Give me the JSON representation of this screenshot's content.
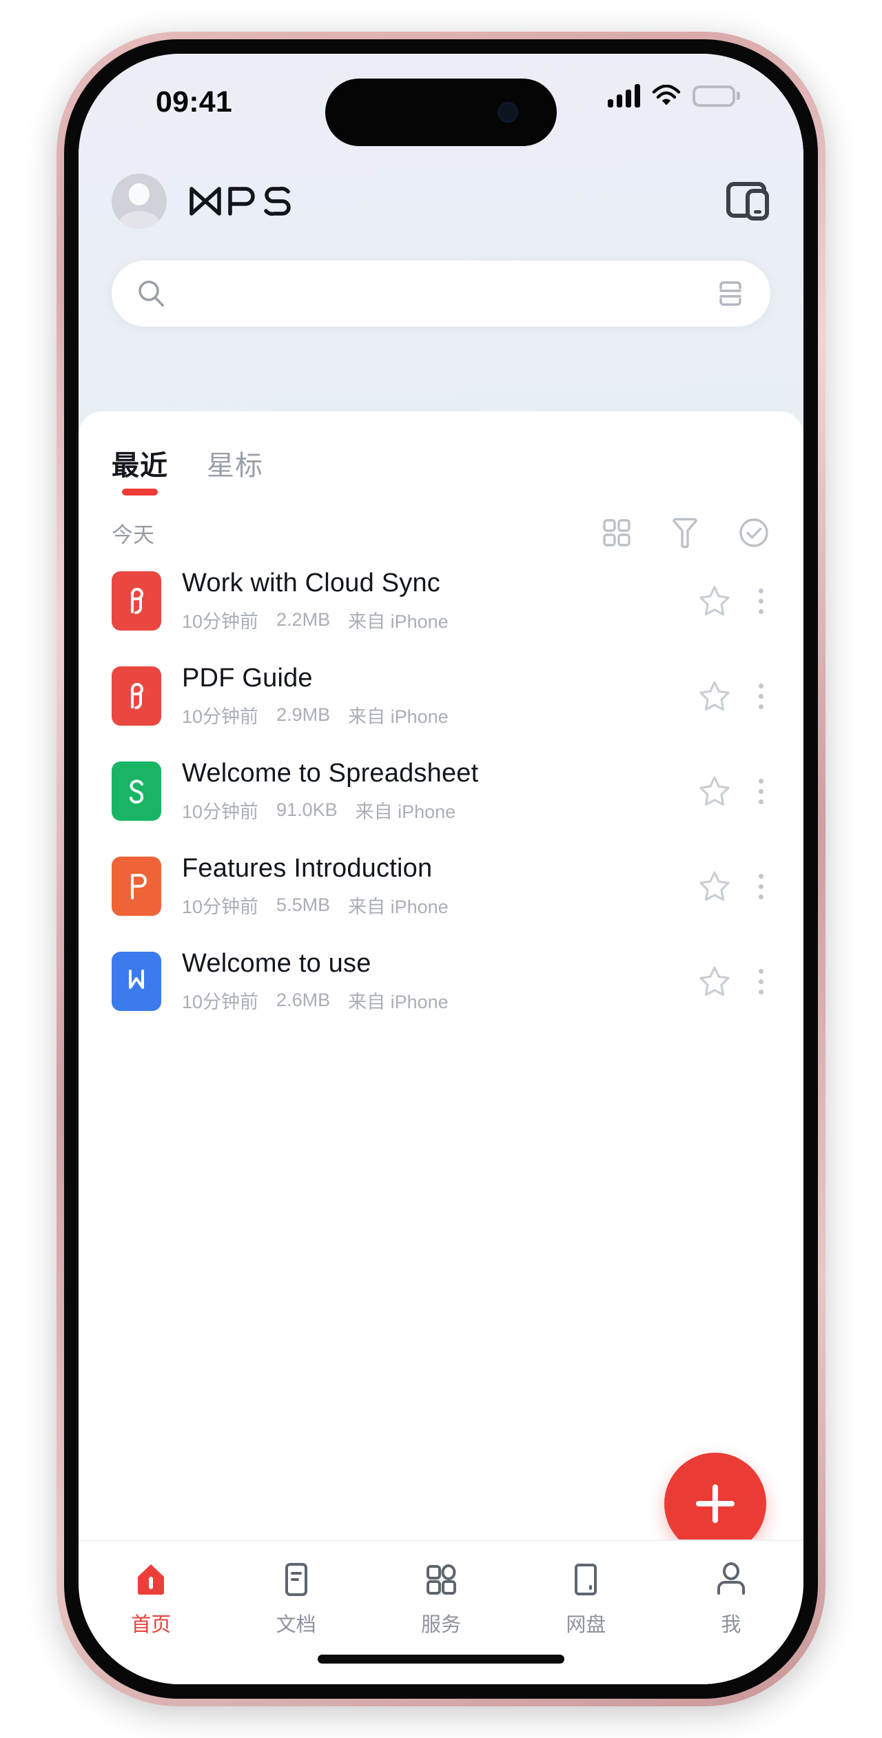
{
  "status_bar": {
    "time": "09:41",
    "signal_icon": "cellular-signal-icon",
    "wifi_icon": "wifi-icon",
    "battery_icon": "battery-full-icon"
  },
  "header": {
    "avatar": "user-avatar",
    "brand": "WPS",
    "cast_icon": "multi-screen-cast-icon"
  },
  "search": {
    "placeholder": "",
    "value": "",
    "search_icon": "search-icon",
    "scan_icon": "document-scan-icon"
  },
  "tabs": [
    {
      "label": "最近",
      "active": true
    },
    {
      "label": "星标",
      "active": false
    }
  ],
  "section": {
    "label": "今天",
    "actions": [
      {
        "name": "grid-view-icon",
        "label": ""
      },
      {
        "name": "filter-funnel-icon",
        "label": ""
      },
      {
        "name": "check-circle-icon",
        "label": ""
      }
    ]
  },
  "files": [
    {
      "title": "Work with Cloud Sync",
      "time": "10分钟前",
      "size": "2.2MB",
      "source": "来自 iPhone",
      "type": "pdf",
      "icon_color": "#e9473f",
      "starred": false
    },
    {
      "title": "PDF Guide",
      "time": "10分钟前",
      "size": "2.9MB",
      "source": "来自 iPhone",
      "type": "pdf",
      "icon_color": "#e9473f",
      "starred": false
    },
    {
      "title": "Welcome to Spreadsheet",
      "time": "10分钟前",
      "size": "91.0KB",
      "source": "来自 iPhone",
      "type": "spreadsheet",
      "icon_color": "#18b565",
      "starred": false
    },
    {
      "title": "Features Introduction",
      "time": "10分钟前",
      "size": "5.5MB",
      "source": "来自 iPhone",
      "type": "presentation",
      "icon_color": "#ef6436",
      "starred": false
    },
    {
      "title": "Welcome to use",
      "time": "10分钟前",
      "size": "2.6MB",
      "source": "来自 iPhone",
      "type": "document",
      "icon_color": "#3b7bee",
      "starred": false
    }
  ],
  "fab": {
    "label": "+",
    "color": "#eb3b35",
    "name": "create-new-button"
  },
  "bottom_nav": [
    {
      "label": "首页",
      "icon": "home-icon",
      "active": true
    },
    {
      "label": "文档",
      "icon": "document-icon",
      "active": false
    },
    {
      "label": "服务",
      "icon": "services-grid-icon",
      "active": false
    },
    {
      "label": "网盘",
      "icon": "cloud-drive-icon",
      "active": false
    },
    {
      "label": "我",
      "icon": "profile-icon",
      "active": false
    }
  ],
  "colors": {
    "accent": "#ec3f39",
    "text_primary": "#11161c",
    "text_muted": "#a9aeb7",
    "card_bg": "#ffffff"
  }
}
